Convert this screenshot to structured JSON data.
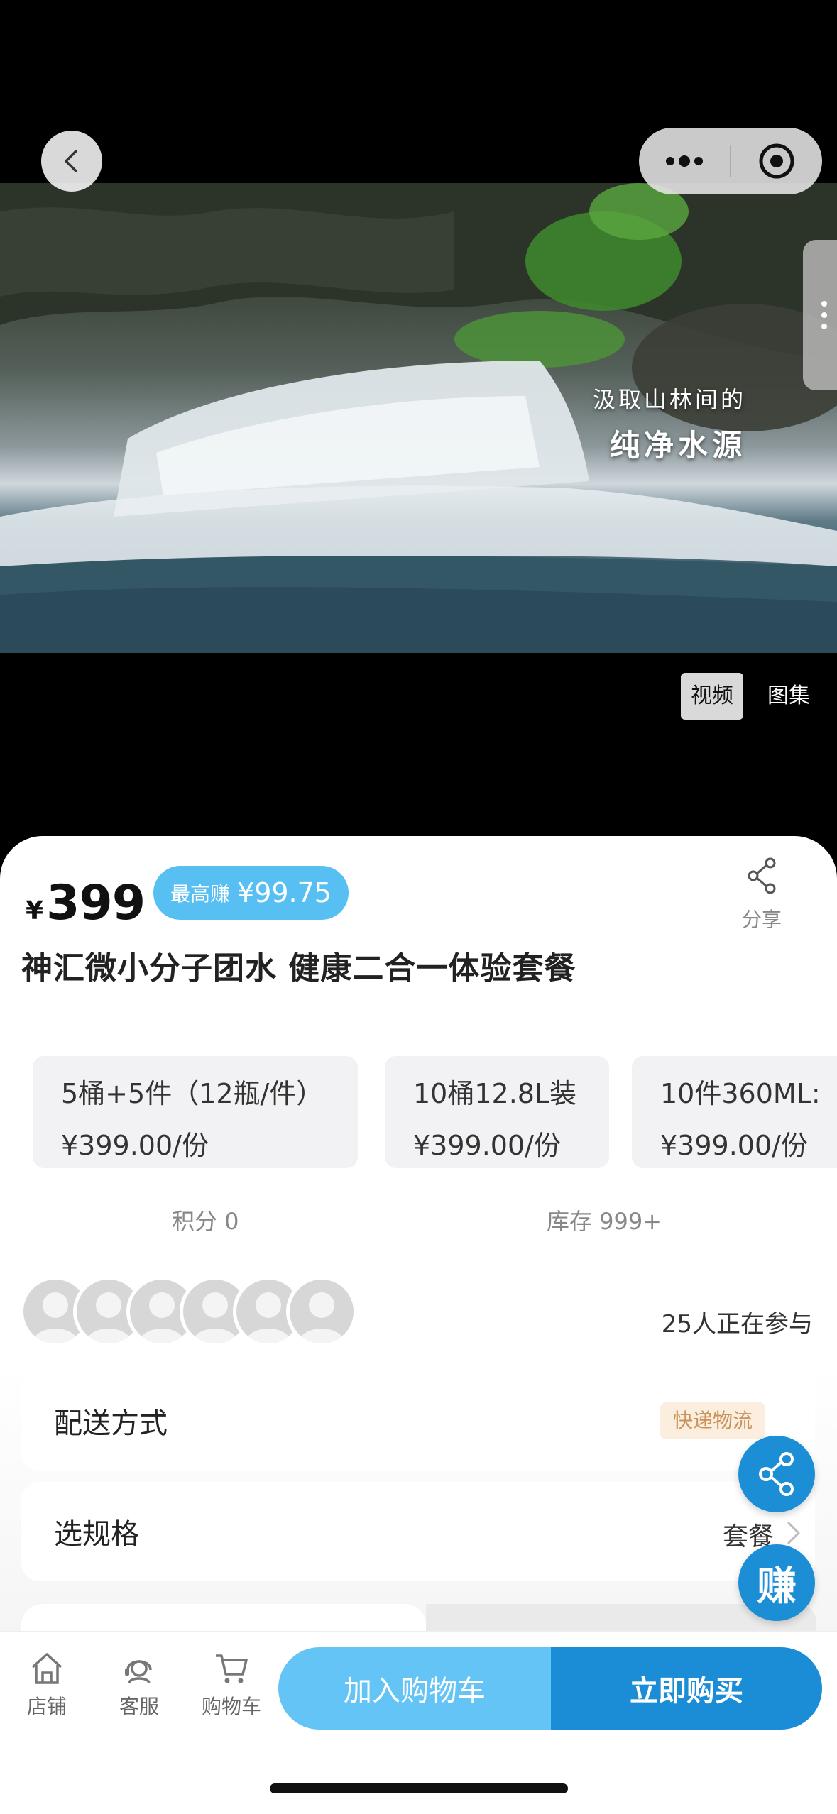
{
  "video": {
    "caption_line1": "汲取山林间的",
    "caption_line2": "纯净水源"
  },
  "media_tabs": [
    {
      "label": "视频",
      "active": true
    },
    {
      "label": "图集",
      "active": false
    }
  ],
  "product": {
    "currency": "¥",
    "price": "399",
    "earn_label": "最高赚",
    "earn_value": "¥99.75",
    "title": "神汇微小分子团水 健康二合一体验套餐",
    "share_label": "分享"
  },
  "skus": [
    {
      "name": "5桶+5件（12瓶/件）",
      "price": "¥399.00/份"
    },
    {
      "name": "10桶12.8L装",
      "price": "¥399.00/份"
    },
    {
      "name": "10件360ML:",
      "price": "¥399.00/份"
    }
  ],
  "meta": {
    "points": "积分 0",
    "stock": "库存 999+"
  },
  "participants": {
    "text": "25人正在参与",
    "avatar_count": 6
  },
  "delivery": {
    "label": "配送方式",
    "tag": "快递物流"
  },
  "spec": {
    "label": "选规格",
    "value": "套餐"
  },
  "fab": {
    "earn_label": "赚"
  },
  "bottom_nav": [
    {
      "label": "店铺",
      "icon": "store-icon"
    },
    {
      "label": "客服",
      "icon": "customer-service-icon"
    },
    {
      "label": "购物车",
      "icon": "cart-icon"
    }
  ],
  "actions": {
    "add_to_cart": "加入购物车",
    "buy_now": "立即购买"
  },
  "colors": {
    "accent_light": "#64c4f5",
    "accent_dark": "#1a8dd6",
    "badge": "#58bff2",
    "tag_bg": "#fbeede",
    "tag_text": "#c8925a"
  }
}
